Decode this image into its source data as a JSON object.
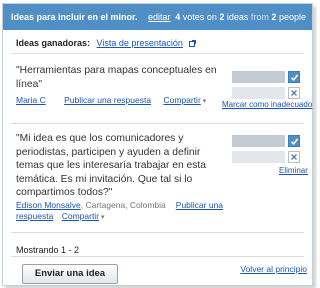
{
  "header": {
    "title": "Ideas para incluir en el minor.",
    "edit_label": "editar",
    "votes_count": "4",
    "votes_word": "votes",
    "on_word": "on",
    "ideas_count": "2",
    "ideas_word": "ideas",
    "from_word": "from",
    "people_count": "2",
    "people_word": "people"
  },
  "subheader": {
    "label": "Ideas ganadoras:",
    "preview_link": "Vista de presentación"
  },
  "ideas": [
    {
      "text": "\"Herramientas para mapas conceptuales en línea\"",
      "author": "Maria C",
      "location": "",
      "reply_label": "Publicar una respuesta",
      "share_label": "Compartir",
      "vote_up_fraction": 1.0,
      "vote_down_fraction": 0.0,
      "action_label": "Marcar como inadecuado"
    },
    {
      "text": "\"Mi idea es que los comunicadores y periodistas, participen y ayuden a definir temas que les interesaría trabajar en esta temática. Es mi invitación. Que tal si lo compartimos todos?\"",
      "author": "Edison Monsalve",
      "location": ", Cartagena, Colombia",
      "reply_label": "Publicar una respuesta",
      "share_label": "Compartir",
      "vote_up_fraction": 1.0,
      "vote_down_fraction": 0.0,
      "action_label": "Eliminar"
    }
  ],
  "footer": {
    "showing": "Mostrando 1 - 2",
    "submit_label": "Enviar una idea",
    "back_label": "Volver al principio"
  },
  "colors": {
    "header_bg": "#4f8fc6",
    "link": "#1a55b5"
  },
  "icons": [
    "external-link-icon",
    "check-icon",
    "x-icon",
    "caret-down-icon"
  ]
}
